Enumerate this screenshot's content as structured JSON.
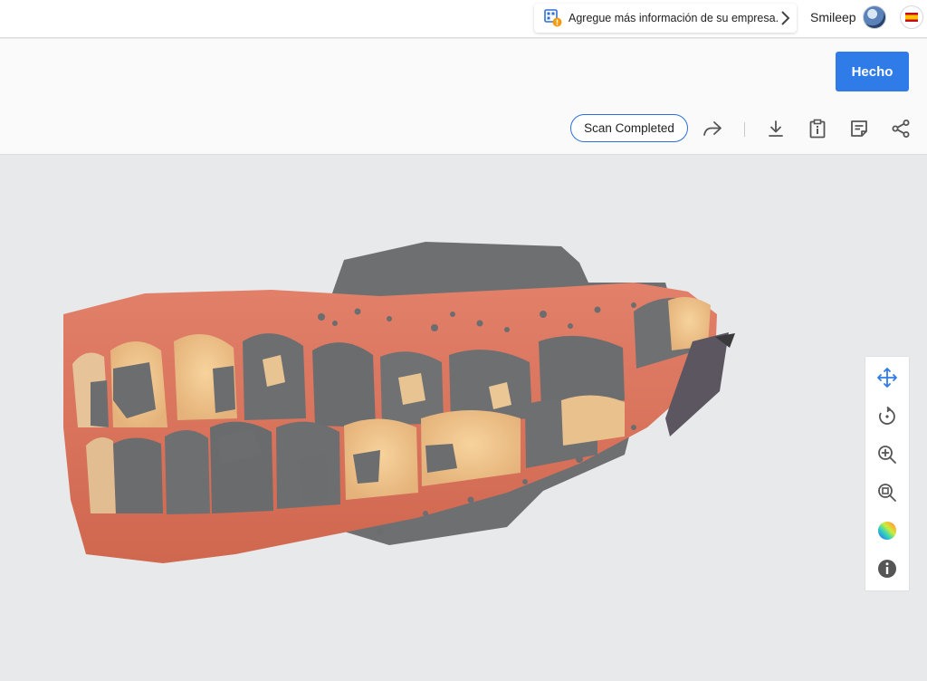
{
  "topbar": {
    "notice_text": "Agregue más información de su empresa.",
    "user_name": "Smileep",
    "notice_icon": "company-info-warning-icon",
    "chevron_icon": "chevron-right-icon",
    "avatar_icon": "avatar",
    "language_icon": "spain-flag-icon"
  },
  "header": {
    "done_label": "Hecho",
    "status_label": "Scan Completed",
    "accent_color": "#2f7be8",
    "tools": [
      "forward-icon",
      "download-icon",
      "clipboard-info-icon",
      "notes-icon",
      "share-icon"
    ]
  },
  "viewer": {
    "tools": [
      "move-icon",
      "rotate-icon",
      "zoom-in-icon",
      "zoom-fit-icon",
      "color-map-icon",
      "info-icon"
    ],
    "active_tool": "move-icon"
  }
}
